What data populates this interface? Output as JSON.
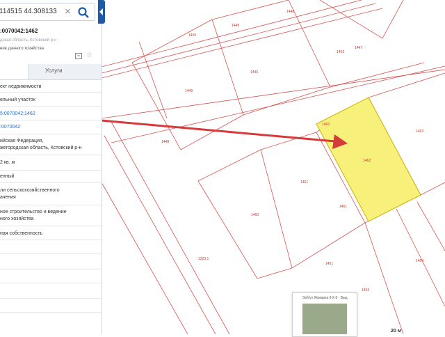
{
  "search": {
    "value": "114515 44.308133"
  },
  "parcel": {
    "cadastral_number": ":0070042:1462",
    "region_line": "дская область, Кстовский р-н",
    "use_line": "ние дачного хозяйства"
  },
  "tabs": {
    "services": "Услуги"
  },
  "details": [
    "ект недвижимости",
    "ельный участок",
    "5:0070042:1462",
    ":0070042",
    "ийская Федерация,",
    "жегородская область, Кстовский р-н",
    "2 кв. м",
    "енный",
    "ли сельскохозяйственного",
    "ачения",
    "ное строительство и ведение",
    "ного хозяйства",
    "ная собственность"
  ],
  "map": {
    "parcel_labels": [
      "1448",
      "1449",
      "1447",
      "1446",
      "1450",
      "1449",
      "1448",
      "1463",
      "1462",
      "1462",
      "1461",
      "1460",
      "1461",
      "1464",
      "1453",
      "1452",
      "1323:1",
      "1451"
    ],
    "highlight_color": "#f7f07a",
    "arrow_color": "#d63a3a",
    "thumbnail_title": "Заб/ул Ярмарка 9-2-5 · Выд",
    "scale_label": "20 м"
  }
}
